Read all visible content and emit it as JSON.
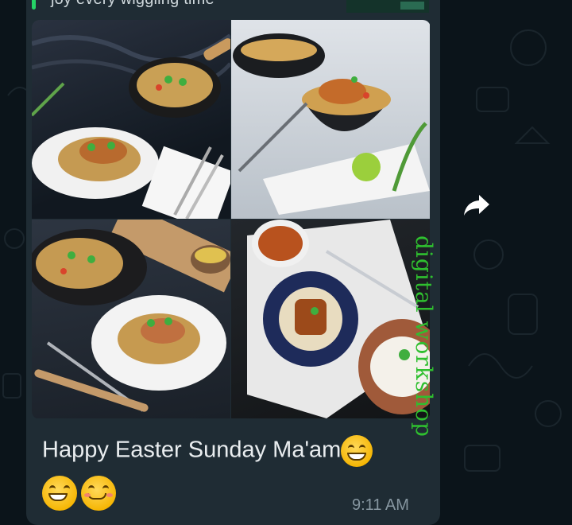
{
  "previous_message": {
    "text": "joy every wiggling time"
  },
  "message": {
    "images": [
      {
        "alt": "fried rice with chicken on white plate"
      },
      {
        "alt": "rice bowl with chicken and lime"
      },
      {
        "alt": "rice plate with peas on dark table"
      },
      {
        "alt": "chicken with rice on blue plate and curry bowl"
      }
    ],
    "caption": "Happy Easter Sunday Ma'am",
    "caption_emoji": "grinning-face-icon",
    "emoji_line": [
      "grinning-face-icon",
      "smiling-face-icon"
    ],
    "time": "9:11 AM"
  },
  "watermark": "digital workshop",
  "colors": {
    "background": "#0b141a",
    "bubble": "#1f2c34",
    "text": "#e9edef",
    "time": "#8696a0",
    "watermark": "#2fbf2f",
    "accent": "#25d366"
  },
  "icons": {
    "forward": "forward-arrow-icon"
  }
}
